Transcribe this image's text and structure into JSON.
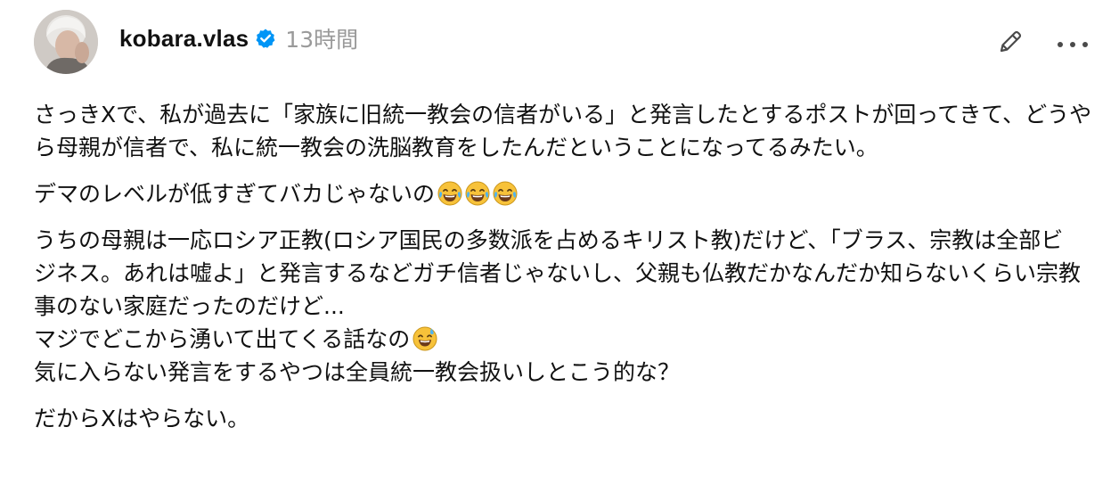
{
  "post": {
    "author": {
      "username": "kobara.vlas",
      "verified": true,
      "avatar_icon": "avatar"
    },
    "timestamp": "13時間",
    "actions": {
      "edit_icon": "pencil-icon",
      "more_icon": "more-icon"
    },
    "paragraphs": [
      {
        "lines": [
          "さっきXで、私が過去に「家族に旧統一教会の信者がいる」と発言したとするポストが回ってきて、どうや",
          "ら母親が信者で、私に統一教会の洗脳教育をしたんだということになってるみたい。"
        ]
      },
      {
        "lines": [
          "デマのレベルが低すぎてバカじゃないの"
        ],
        "trailing_emoji": [
          "face-with-tears-of-joy",
          "face-with-tears-of-joy",
          "face-with-tears-of-joy"
        ]
      },
      {
        "lines": [
          "うちの母親は一応ロシア正教(ロシア国民の多数派を占めるキリスト教)だけど、「ブラス、宗教は全部ビ",
          "ジネス。あれは嘘よ」と発言するなどガチ信者じゃないし、父親も仏教だかなんだか知らないくらい宗教",
          "事のない家庭だったのだけど...",
          "マジでどこから湧いて出てくる話なの",
          "気に入らない発言をするやつは全員統一教会扱いしとこう的な？"
        ],
        "line4_emoji": "grinning-face-with-sweat"
      },
      {
        "lines": [
          "だからXはやらない。"
        ]
      }
    ]
  },
  "colors": {
    "verified_blue": "#0095f6",
    "timestamp_gray": "#9a9a9a",
    "icon_gray": "#4a4a4a",
    "emoji_yellow": "#f7c23a"
  }
}
